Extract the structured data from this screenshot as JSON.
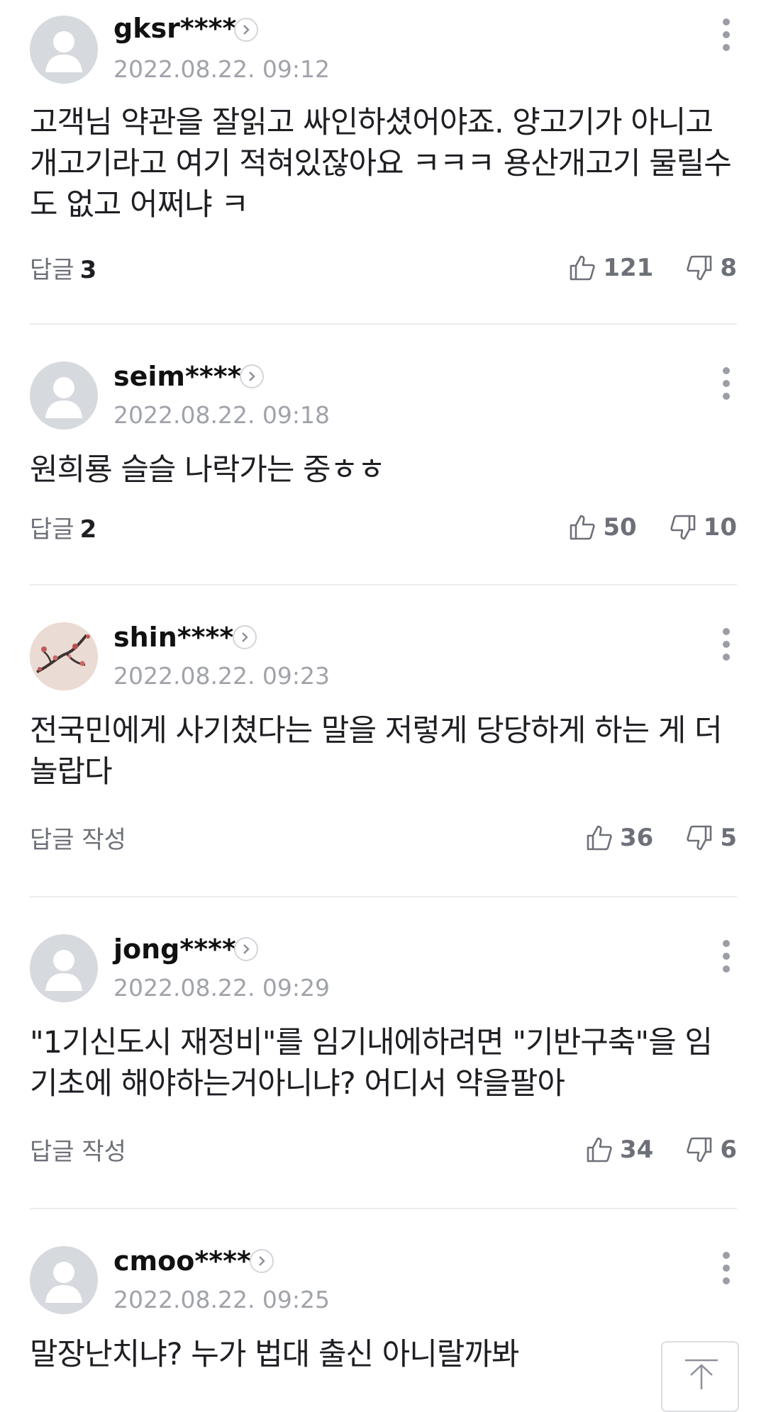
{
  "comments": [
    {
      "nickname": "gksr****",
      "date": "2022.08.22. 09:12",
      "text": "고객님 약관을 잘읽고 싸인하셨어야죠. 양고기가 아니고 개고기라고 여기 적혀있잖아요 ㅋㅋㅋ 용산개고기 물릴수도 없고 어쩌냐 ㅋ",
      "reply_label": "답글",
      "reply_count": "3",
      "likes": "121",
      "dislikes": "8",
      "avatar": "default"
    },
    {
      "nickname": "seim****",
      "date": "2022.08.22. 09:18",
      "text": "원희룡 슬슬 나락가는 중ㅎㅎ",
      "reply_label": "답글",
      "reply_count": "2",
      "likes": "50",
      "dislikes": "10",
      "avatar": "default"
    },
    {
      "nickname": "shin****",
      "date": "2022.08.22. 09:23",
      "text": "전국민에게 사기쳤다는 말을 저렇게 당당하게 하는 게 더 놀랍다",
      "reply_label": "답글 작성",
      "reply_count": "",
      "likes": "36",
      "dislikes": "5",
      "avatar": "plum-blossom-painting"
    },
    {
      "nickname": "jong****",
      "date": "2022.08.22. 09:29",
      "text": "\"1기신도시 재정비\"를 임기내에하려면 \"기반구축\"을 임기초에 해야하는거아니냐? 어디서 약을팔아",
      "reply_label": "답글 작성",
      "reply_count": "",
      "likes": "34",
      "dislikes": "6",
      "avatar": "default"
    },
    {
      "nickname": "cmoo****",
      "date": "2022.08.22. 09:25",
      "text": "말장난치냐? 누가 법대 출신 아니랄까봐",
      "avatar": "default"
    }
  ],
  "icons": {
    "like": "thumbs-up-outline",
    "dislike": "thumbs-down-outline",
    "more": "vertical-ellipsis",
    "profile": "chevron-right-circle",
    "scroll_top": "arrow-up-to-top"
  },
  "colors": {
    "text": "#1e1e23",
    "meta": "#a0a3aa",
    "icon": "#6d7078",
    "divider": "#ececf0",
    "avatar_bg": "#d6d9de"
  }
}
